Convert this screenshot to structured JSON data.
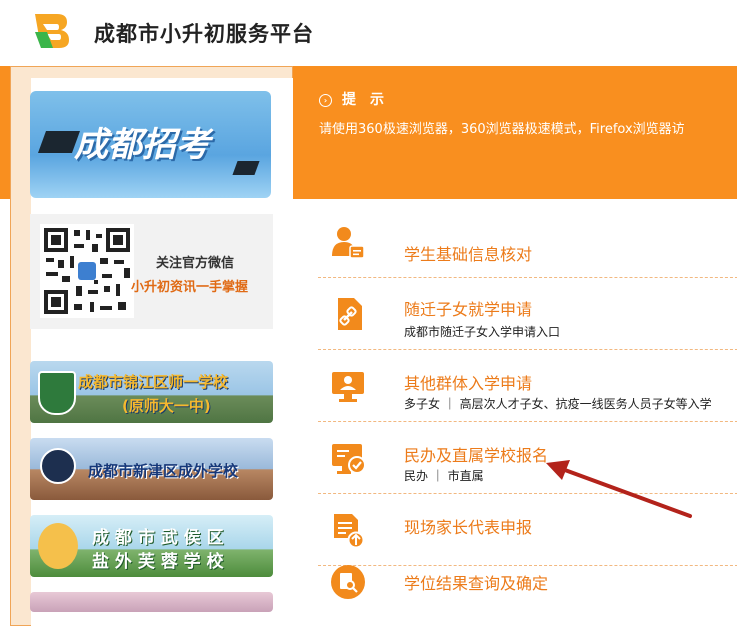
{
  "header": {
    "site_title": "成都市小升初服务平台"
  },
  "notice": {
    "title": "提　示",
    "text": "请使用360极速浏览器，360浏览器极速模式，Firefox浏览器访"
  },
  "sidebar": {
    "banner_text": "成都招考",
    "wechat": {
      "line1": "关注官方微信",
      "line2": "小升初资讯一手掌握"
    },
    "schools": [
      {
        "line1": "成都市锦江区师一学校",
        "line2": "(原师大一中)"
      },
      {
        "line1": "成都市新津区成外学校",
        "line2": ""
      },
      {
        "line1": "成 都 市 武 侯 区",
        "line2": "盐 外 芙 蓉 学 校"
      }
    ]
  },
  "menu": [
    {
      "title": "学生基础信息核对",
      "sub": "",
      "icon": "id-card-icon"
    },
    {
      "title": "随迁子女就学申请",
      "sub": "成都市随迁子女入学申请入口",
      "icon": "link-doc-icon"
    },
    {
      "title": "其他群体入学申请",
      "sub": "多子女 ｜ 高层次人才子女、抗疫一线医务人员子女等入学",
      "icon": "monitor-user-icon"
    },
    {
      "title": "民办及直属学校报名",
      "sub": "民办 ｜ 市直属",
      "icon": "register-check-icon"
    },
    {
      "title": "现场家长代表申报",
      "sub": "",
      "icon": "upload-doc-icon"
    },
    {
      "title": "学位结果查询及确定",
      "sub": "",
      "icon": "search-result-icon"
    }
  ],
  "colors": {
    "accent": "#f98f1f",
    "menu_text": "#ec7b1a",
    "arrow": "#b3231b"
  }
}
